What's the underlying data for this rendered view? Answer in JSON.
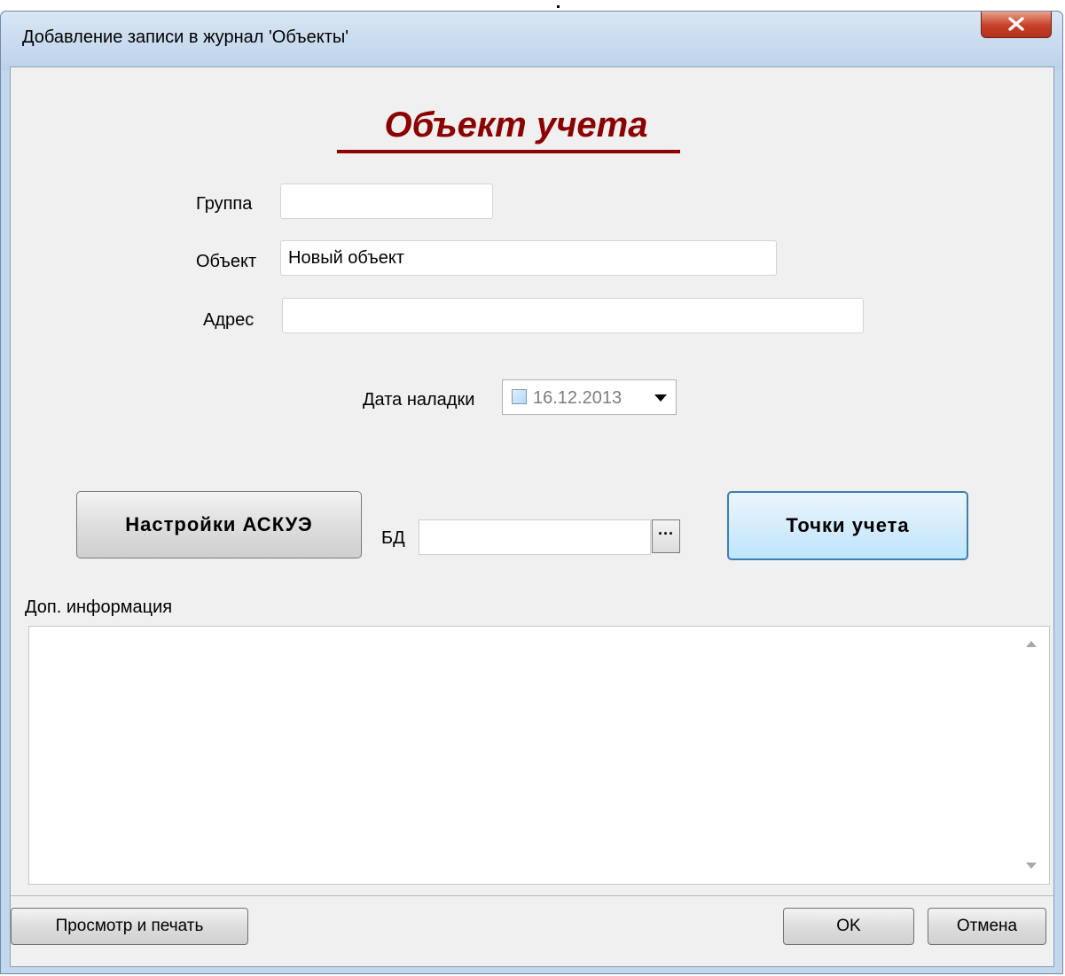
{
  "window": {
    "title": "Добавление записи в журнал 'Объекты'"
  },
  "form": {
    "heading": "Объект учета",
    "group": {
      "label": "Группа",
      "value": ""
    },
    "object": {
      "label": "Объект",
      "value": "Новый объект"
    },
    "address": {
      "label": "Адрес",
      "value": ""
    },
    "setup_date": {
      "label": "Дата наладки",
      "value": "16.12.2013",
      "checked": false
    },
    "db": {
      "label": "БД",
      "value": "",
      "browse_label": "···"
    },
    "asku_button": "Настройки АСКУЭ",
    "points_button": "Точки учета",
    "extra_info": {
      "label": "Доп. информация",
      "value": ""
    }
  },
  "footer": {
    "preview_button": "Просмотр и печать",
    "ok_button": "OK",
    "cancel_button": "Отмена"
  },
  "icons": {
    "close": "close-icon",
    "dropdown": "chevron-down-icon",
    "scroll_up": "scroll-up-arrow-icon",
    "scroll_down": "scroll-down-arrow-icon"
  },
  "colors": {
    "heading": "#8b0000",
    "accent_button_border": "#3c7fb1",
    "close_button": "#c7402a"
  }
}
